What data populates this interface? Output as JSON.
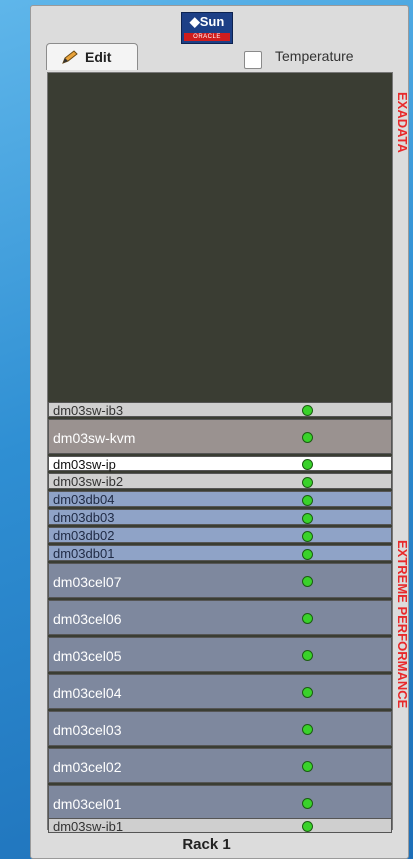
{
  "logo": {
    "sun": "◆Sun",
    "oracle": "ORACLE"
  },
  "toolbar": {
    "edit_label": "Edit",
    "temperature_label": "Temperature"
  },
  "side_labels": {
    "top": "EXADATA",
    "bottom": "EXTREME PERFORMANCE"
  },
  "rack": {
    "title": "Rack 1",
    "slots": [
      {
        "name": "dm03sw-ib3",
        "status": "green"
      },
      {
        "name": "dm03sw-kvm",
        "status": "green"
      },
      {
        "name": "dm03sw-ip",
        "status": "green"
      },
      {
        "name": "dm03sw-ib2",
        "status": "green"
      },
      {
        "name": "dm03db04",
        "status": "green"
      },
      {
        "name": "dm03db03",
        "status": "green"
      },
      {
        "name": "dm03db02",
        "status": "green"
      },
      {
        "name": "dm03db01",
        "status": "green"
      },
      {
        "name": "dm03cel07",
        "status": "green"
      },
      {
        "name": "dm03cel06",
        "status": "green"
      },
      {
        "name": "dm03cel05",
        "status": "green"
      },
      {
        "name": "dm03cel04",
        "status": "green"
      },
      {
        "name": "dm03cel03",
        "status": "green"
      },
      {
        "name": "dm03cel02",
        "status": "green"
      },
      {
        "name": "dm03cel01",
        "status": "green"
      },
      {
        "name": "dm03sw-ib1",
        "status": "green"
      }
    ]
  },
  "colors": {
    "status_green": "#39d22a",
    "side_label_red": "#e8292b",
    "rack_empty": "#3a3d33"
  }
}
